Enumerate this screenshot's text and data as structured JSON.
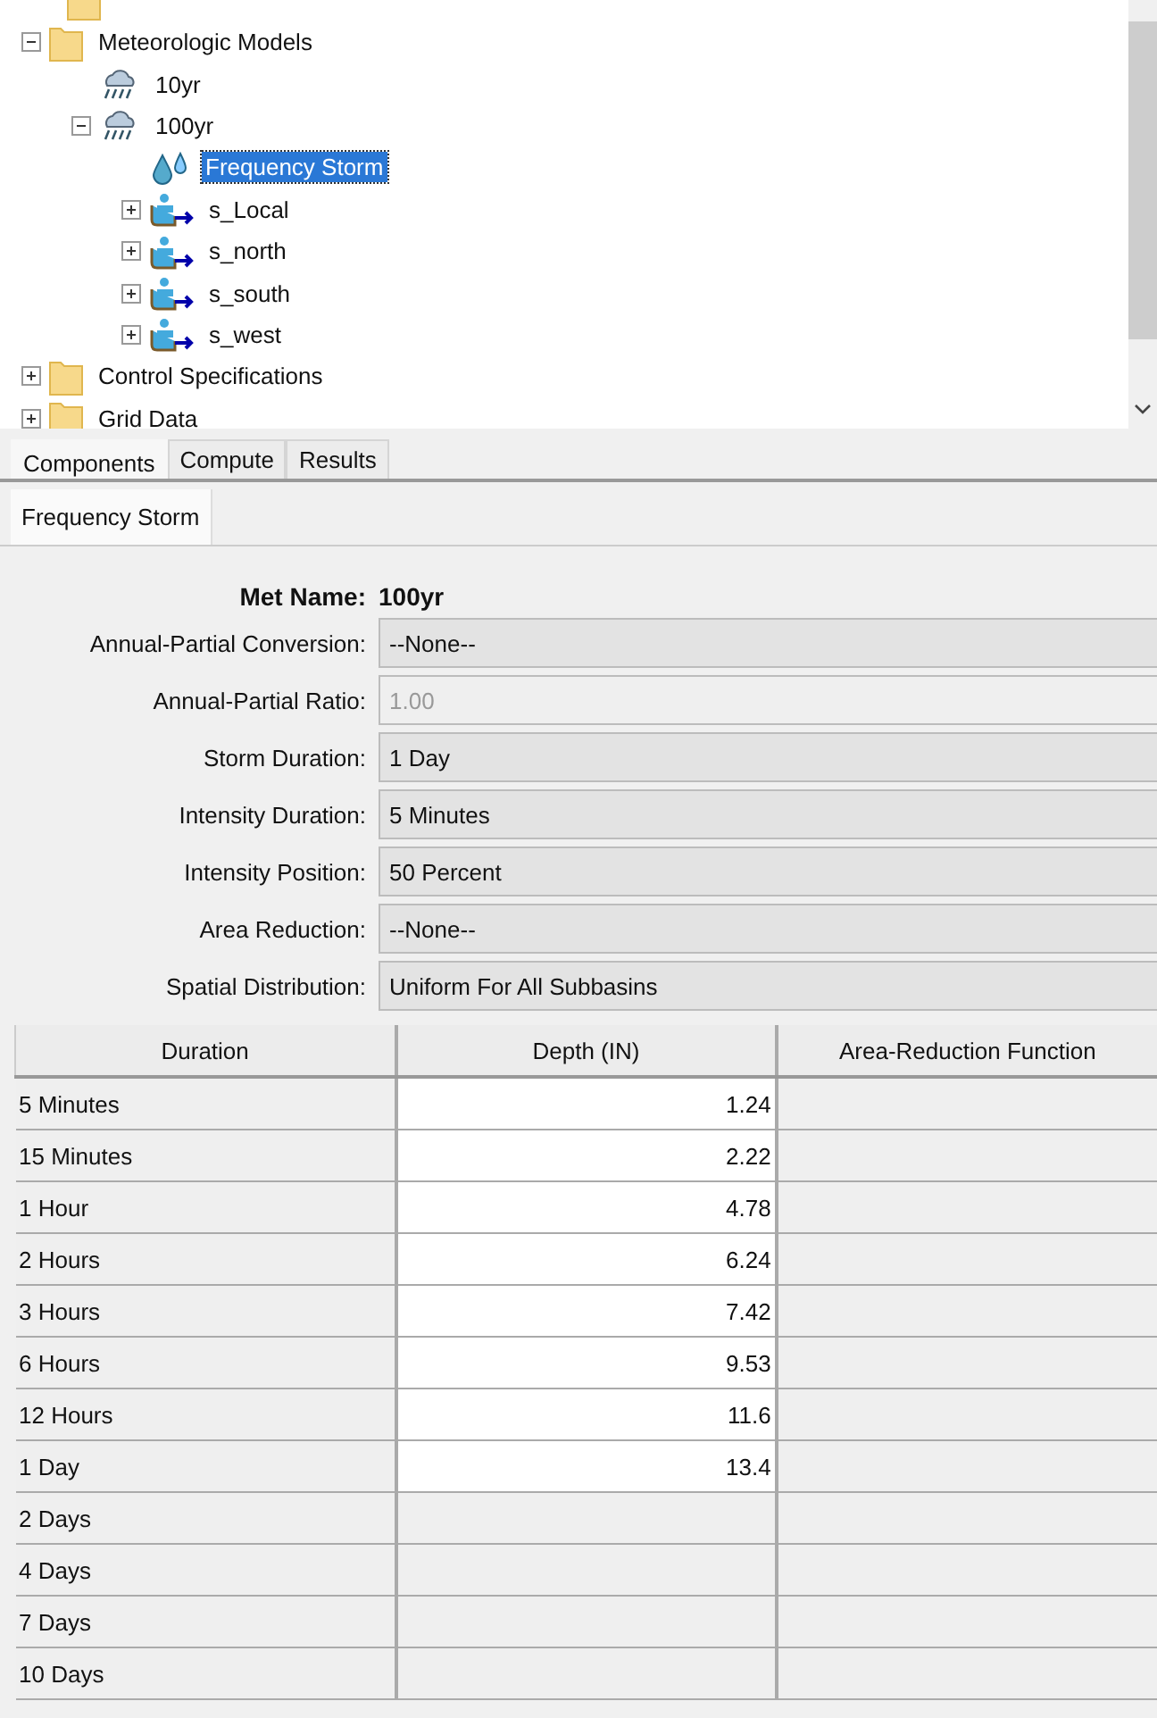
{
  "tree": {
    "items": [
      {
        "label": "Meteorologic Models",
        "kind": "folder",
        "expanded": true,
        "selected": false,
        "children": [
          {
            "label": "10yr",
            "kind": "met",
            "selected": false
          },
          {
            "label": "100yr",
            "kind": "met",
            "expanded": true,
            "selected": false,
            "children": [
              {
                "label": "Frequency Storm",
                "kind": "storm",
                "selected": true
              },
              {
                "label": "s_Local",
                "kind": "subbasin",
                "expanded": false,
                "selected": false
              },
              {
                "label": "s_north",
                "kind": "subbasin",
                "expanded": false,
                "selected": false
              },
              {
                "label": "s_south",
                "kind": "subbasin",
                "expanded": false,
                "selected": false
              },
              {
                "label": "s_west",
                "kind": "subbasin",
                "expanded": false,
                "selected": false
              }
            ]
          }
        ]
      },
      {
        "label": "Control Specifications",
        "kind": "folder",
        "expanded": false,
        "selected": false
      },
      {
        "label": "Grid Data",
        "kind": "folder",
        "expanded": false,
        "selected": false
      }
    ]
  },
  "tabs": [
    {
      "label": "Components",
      "selected": true
    },
    {
      "label": "Compute",
      "selected": false
    },
    {
      "label": "Results",
      "selected": false
    }
  ],
  "editor": {
    "tab": "Frequency Storm",
    "met_name": {
      "label": "Met Name:",
      "value": "100yr"
    },
    "fields": [
      {
        "label": "Annual-Partial Conversion:",
        "value": "--None--",
        "disabled": false
      },
      {
        "label": "Annual-Partial Ratio:",
        "value": "1.00",
        "disabled": true
      },
      {
        "label": "Storm Duration:",
        "value": "1 Day",
        "disabled": false
      },
      {
        "label": "Intensity Duration:",
        "value": "5 Minutes",
        "disabled": false
      },
      {
        "label": "Intensity Position:",
        "value": "50 Percent",
        "disabled": false
      },
      {
        "label": "Area Reduction:",
        "value": "--None--",
        "disabled": false
      },
      {
        "label": "Spatial Distribution:",
        "value": "Uniform For All Subbasins",
        "disabled": false
      }
    ]
  },
  "table": {
    "columns": [
      "Duration",
      "Depth (IN)",
      "Area-Reduction Function"
    ],
    "rows": [
      {
        "duration": "5 Minutes",
        "depth": "1.24",
        "editable": true
      },
      {
        "duration": "15 Minutes",
        "depth": "2.22",
        "editable": true
      },
      {
        "duration": "1 Hour",
        "depth": "4.78",
        "editable": true
      },
      {
        "duration": "2 Hours",
        "depth": "6.24",
        "editable": true
      },
      {
        "duration": "3 Hours",
        "depth": "7.42",
        "editable": true
      },
      {
        "duration": "6 Hours",
        "depth": "9.53",
        "editable": true
      },
      {
        "duration": "12 Hours",
        "depth": "11.6",
        "editable": true
      },
      {
        "duration": "1 Day",
        "depth": "13.4",
        "editable": true
      },
      {
        "duration": "2 Days",
        "editable": false
      },
      {
        "duration": "4 Days",
        "editable": false
      },
      {
        "duration": "7 Days",
        "editable": false
      },
      {
        "duration": "10 Days",
        "editable": false
      }
    ]
  }
}
